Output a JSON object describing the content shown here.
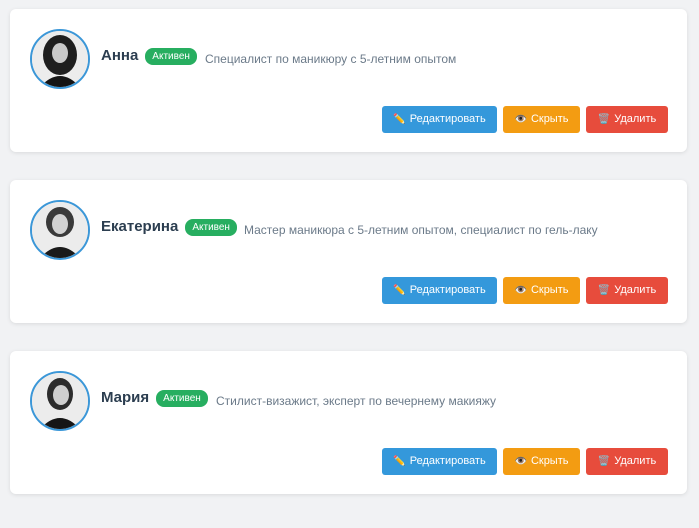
{
  "actions": {
    "edit_icon": "✏️",
    "edit_label": "Редактировать",
    "hide_icon": "👁️",
    "hide_label": "Скрыть",
    "delete_icon": "🗑️",
    "delete_label": "Удалить"
  },
  "colors": {
    "avatar_border": "#3b97d8",
    "status_badge": "#27ae60",
    "edit_button": "#3498db",
    "hide_button": "#f39c12",
    "delete_button": "#e74c3c"
  },
  "specialists": [
    {
      "name": "Анна",
      "status": "Активен",
      "description": "Специалист по маникюру с 5-летним опытом"
    },
    {
      "name": "Екатерина",
      "status": "Активен",
      "description": "Мастер маникюра с 5-летним опытом, специалист по гель-лаку"
    },
    {
      "name": "Мария",
      "status": "Активен",
      "description": "Стилист-визажист, эксперт по вечернему макияжу"
    }
  ]
}
